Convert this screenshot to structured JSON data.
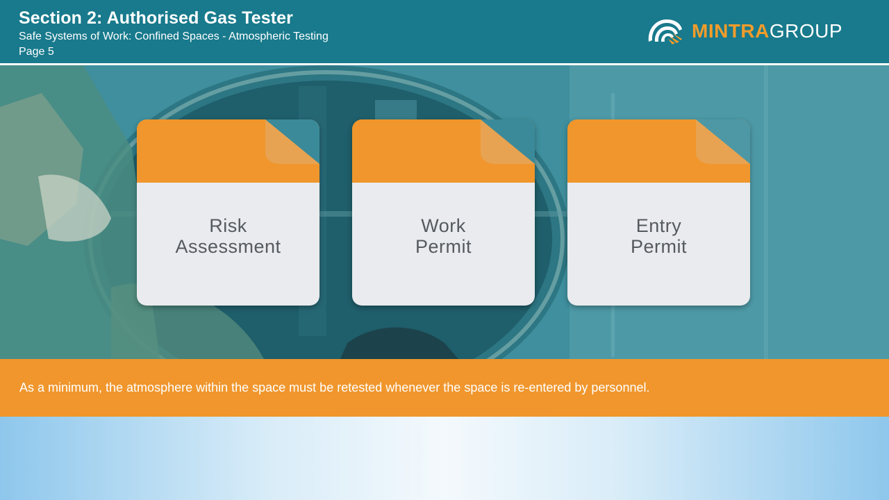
{
  "header": {
    "title": "Section 2: Authorised Gas Tester",
    "subtitle": "Safe Systems of Work: Confined Spaces - Atmospheric Testing",
    "page": "Page 5"
  },
  "logo": {
    "icon": "mintra-logo-icon",
    "brand_part1": "MINTRA",
    "brand_part2": "GROUP"
  },
  "cards": [
    {
      "line1": "Risk",
      "line2": "Assessment"
    },
    {
      "line1": "Work",
      "line2": "Permit"
    },
    {
      "line1": "Entry",
      "line2": "Permit"
    }
  ],
  "banner": {
    "text": "As a minimum, the atmosphere within the space must be retested whenever the space is re-entered by personnel."
  },
  "colors": {
    "header_teal": "#187a8c",
    "accent_orange": "#f0962c",
    "card_body": "#e9ebee",
    "card_text": "#555a5e"
  }
}
